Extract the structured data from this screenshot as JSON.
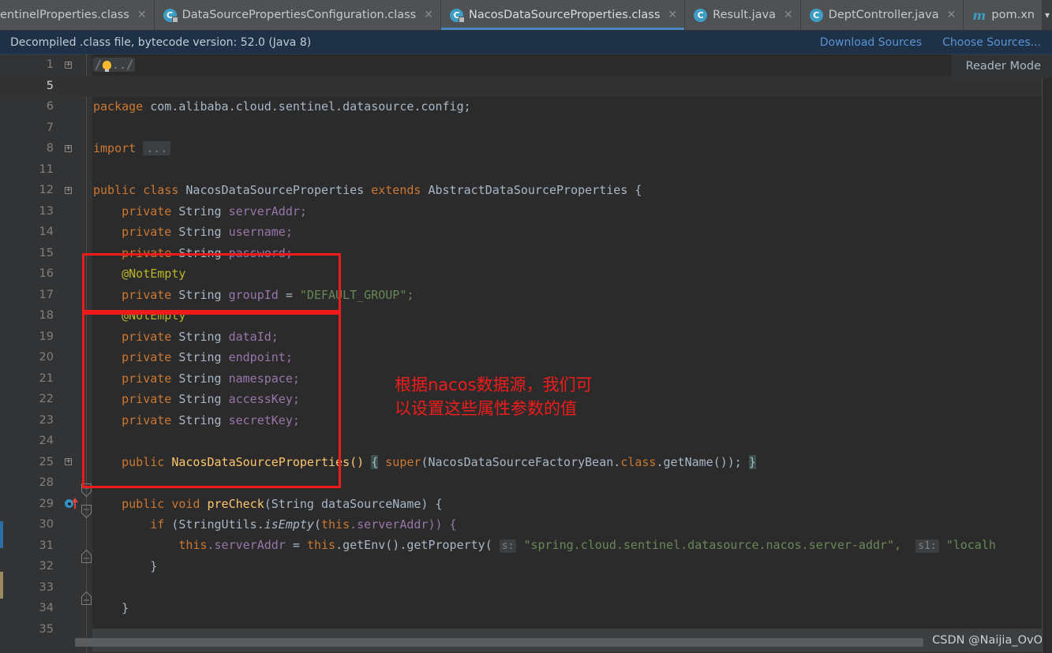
{
  "tabs": [
    {
      "label": "entinelProperties.class",
      "icon": "java-class-icon",
      "active": false,
      "truncated": true,
      "closable": true
    },
    {
      "label": "DataSourcePropertiesConfiguration.class",
      "icon": "java-class-icon",
      "active": false,
      "closable": true
    },
    {
      "label": "NacosDataSourceProperties.class",
      "icon": "java-class-icon",
      "active": true,
      "closable": true
    },
    {
      "label": "Result.java",
      "icon": "java-class-icon",
      "active": false,
      "closable": true
    },
    {
      "label": "DeptController.java",
      "icon": "java-class-icon",
      "active": false,
      "closable": true
    },
    {
      "label": "pom.xn",
      "icon": "maven-icon",
      "active": false,
      "closable": false
    }
  ],
  "tab_overflow_icon": "chevron-down-icon",
  "notification": {
    "message": "Decompiled .class file, bytecode version: 52.0 (Java 8)",
    "download_sources": "Download Sources",
    "choose_sources": "Choose Sources..."
  },
  "editor": {
    "reader_mode": "Reader Mode",
    "current_line": 5,
    "lines": [
      {
        "num": "1",
        "fold": "plus",
        "type": "folded-comment"
      },
      {
        "num": "5",
        "fold": "",
        "type": "blank"
      },
      {
        "num": "6",
        "fold": "",
        "type": "package"
      },
      {
        "num": "7",
        "fold": "",
        "type": "blank"
      },
      {
        "num": "8",
        "fold": "plus",
        "type": "import"
      },
      {
        "num": "11",
        "fold": "",
        "type": "blank"
      },
      {
        "num": "12",
        "fold": "plus",
        "type": "class-decl"
      },
      {
        "num": "13",
        "fold": "",
        "type": "field-serverAddr"
      },
      {
        "num": "14",
        "fold": "",
        "type": "field-username"
      },
      {
        "num": "15",
        "fold": "",
        "type": "field-password"
      },
      {
        "num": "16",
        "fold": "",
        "type": "annot-notempty"
      },
      {
        "num": "17",
        "fold": "",
        "type": "field-groupId"
      },
      {
        "num": "18",
        "fold": "",
        "type": "annot-notempty"
      },
      {
        "num": "19",
        "fold": "",
        "type": "field-dataId"
      },
      {
        "num": "20",
        "fold": "",
        "type": "field-endpoint"
      },
      {
        "num": "21",
        "fold": "",
        "type": "field-namespace"
      },
      {
        "num": "22",
        "fold": "",
        "type": "field-accessKey"
      },
      {
        "num": "23",
        "fold": "",
        "type": "field-secretKey"
      },
      {
        "num": "24",
        "fold": "",
        "type": "blank"
      },
      {
        "num": "25",
        "fold": "plus",
        "type": "ctor"
      },
      {
        "num": "28",
        "fold": "",
        "type": "blank"
      },
      {
        "num": "29",
        "fold": "down",
        "type": "precheck",
        "gutter_icon": "override-method-icon"
      },
      {
        "num": "30",
        "fold": "down",
        "type": "if-isempty"
      },
      {
        "num": "31",
        "fold": "",
        "type": "set-serveraddr"
      },
      {
        "num": "32",
        "fold": "up",
        "type": "close-if"
      },
      {
        "num": "33",
        "fold": "",
        "type": "blank"
      },
      {
        "num": "34",
        "fold": "up",
        "type": "close-method"
      },
      {
        "num": "35",
        "fold": "",
        "type": "blank"
      }
    ],
    "code": {
      "folded_comment": "/ .. /",
      "package_kw": "package",
      "package_name": "com.alibaba.cloud.sentinel.datasource.config;",
      "import_kw": "import",
      "import_folded": "...",
      "class_public": "public",
      "class_kw": "class",
      "class_name": "NacosDataSourceProperties",
      "class_extends": "extends",
      "class_super": "AbstractDataSourceProperties",
      "class_brace": "{",
      "mod_private": "private",
      "type_string": "String",
      "f_serverAddr": "serverAddr;",
      "f_username": "username;",
      "f_password": "password;",
      "annot_notempty": "@NotEmpty",
      "f_groupId": "groupId",
      "f_groupId_eq": "=",
      "f_groupId_val": "\"DEFAULT_GROUP\";",
      "f_dataId": "dataId;",
      "f_endpoint": "endpoint;",
      "f_namespace": "namespace;",
      "f_accessKey": "accessKey;",
      "f_secretKey": "secretKey;",
      "ctor_public": "public",
      "ctor_name": "NacosDataSourceProperties()",
      "ctor_open": "{",
      "ctor_super": "super",
      "ctor_args": "(NacosDataSourceFactoryBean.",
      "ctor_class_kw": "class",
      "ctor_getname": ".getName());",
      "ctor_close": "}",
      "pc_public": "public",
      "pc_void": "void",
      "pc_name": "preCheck",
      "pc_params": "(String dataSourceName) {",
      "if_kw": "if",
      "if_open": "(StringUtils.",
      "if_isempty": "isEmpty",
      "if_this": "this",
      "if_field": ".serverAddr)) {",
      "set_this": "this",
      "set_field": ".serverAddr",
      "set_eq": "=",
      "set_this2": "this",
      "set_getenv": ".getEnv().getProperty(",
      "hint_s": "s:",
      "set_key": "\"spring.cloud.sentinel.datasource.nacos.server-addr\",",
      "hint_s1": "s1:",
      "set_default": "\"localh",
      "brace_close": "}"
    }
  },
  "annotations": {
    "chinese_note": "根据nacos数据源，我们可\n以设置这些属性参数的值",
    "note_color": "#f01c1c",
    "box_color": "#ef1a1a"
  },
  "status": {
    "watermark": "CSDN @Naijia_OvO"
  }
}
